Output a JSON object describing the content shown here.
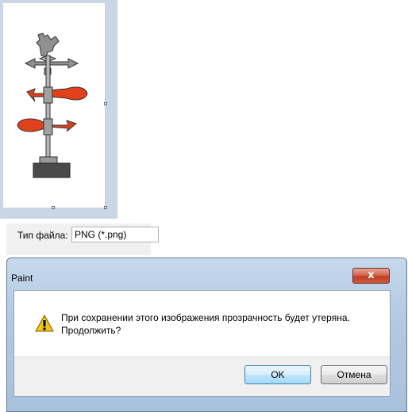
{
  "file_type": {
    "label": "Тип файла:",
    "value": "PNG (*.png)"
  },
  "dialog": {
    "title": "Paint",
    "close_symbol": "x",
    "message_line1": "При сохранении этого изображения прозрачность будет утеряна.",
    "message_line2": "Продолжить?",
    "icon": "warning-icon",
    "ok_label": "OK",
    "cancel_label": "Отмена"
  },
  "colors": {
    "workspace": "#c9d6e6",
    "arrow_red": "#e0411a",
    "vane_grey": "#8f8f8f",
    "base_dark": "#4a4a4a",
    "warning_yellow": "#f5c518"
  }
}
